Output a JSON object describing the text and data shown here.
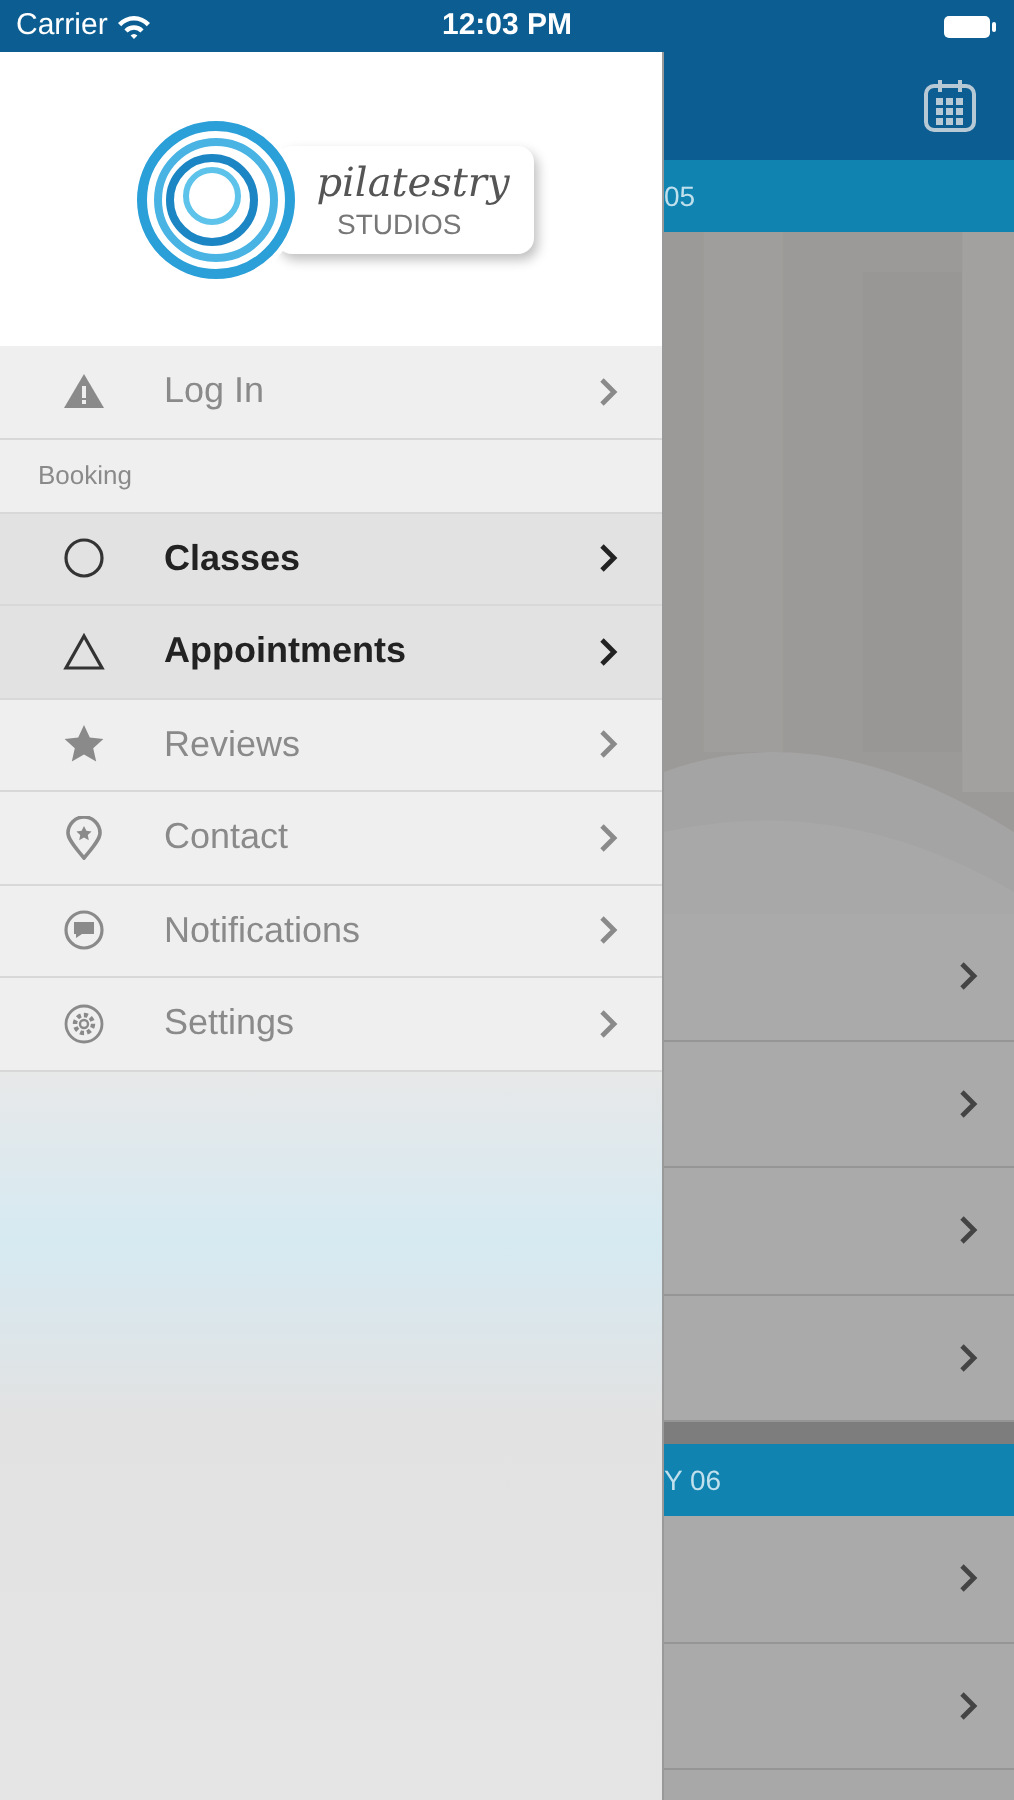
{
  "status_bar": {
    "carrier": "Carrier",
    "time": "12:03 PM"
  },
  "logo": {
    "word": "pilatestry",
    "subword": "STUDIOS"
  },
  "menu": [
    {
      "kind": "item",
      "label": "Log In",
      "active": false
    },
    {
      "kind": "section",
      "label": "Booking"
    },
    {
      "kind": "item",
      "label": "Classes",
      "active": true
    },
    {
      "kind": "item",
      "label": "Appointments",
      "active": true
    },
    {
      "kind": "item",
      "label": "Reviews",
      "active": false
    },
    {
      "kind": "item",
      "label": "Contact",
      "active": false
    },
    {
      "kind": "item",
      "label": "Notifications",
      "active": false
    },
    {
      "kind": "item",
      "label": "Settings",
      "active": false
    }
  ],
  "schedule": [
    {
      "kind": "header",
      "label": "05"
    },
    {
      "kind": "picture"
    },
    {
      "kind": "row"
    },
    {
      "kind": "row"
    },
    {
      "kind": "row"
    },
    {
      "kind": "row"
    },
    {
      "kind": "gap"
    },
    {
      "kind": "header",
      "label": "Y 06"
    },
    {
      "kind": "row"
    },
    {
      "kind": "row"
    }
  ]
}
